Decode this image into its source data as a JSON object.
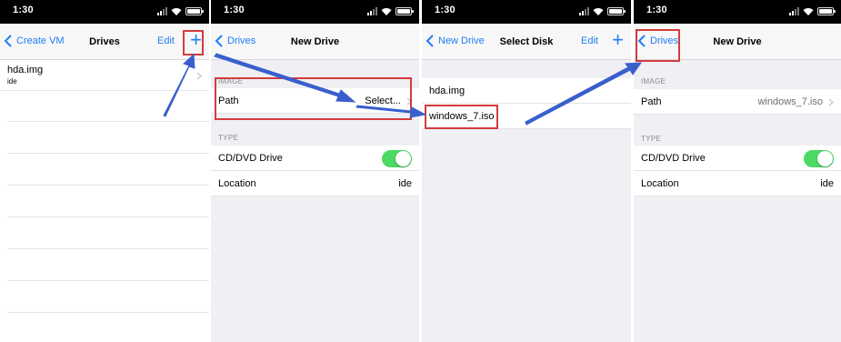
{
  "status": {
    "time": "1:30"
  },
  "screen1": {
    "nav": {
      "back": "Create VM",
      "title": "Drives",
      "edit": "Edit",
      "add": "+"
    },
    "drive": {
      "name": "hda.img",
      "interface": "ide"
    }
  },
  "screen2": {
    "nav": {
      "back": "Drives",
      "title": "New Drive"
    },
    "image_header": "IMAGE",
    "path_label": "Path",
    "path_value": "Select...",
    "type_header": "TYPE",
    "cd_label": "CD/DVD Drive",
    "location_label": "Location",
    "location_value": "ide"
  },
  "screen3": {
    "nav": {
      "back": "New Drive",
      "title": "Select Disk",
      "edit": "Edit",
      "add": "+"
    },
    "files": [
      "hda.img",
      "windows_7.iso"
    ]
  },
  "screen4": {
    "nav": {
      "back": "Drives",
      "title": "New Drive"
    },
    "image_header": "IMAGE",
    "path_label": "Path",
    "path_value": "windows_7.iso",
    "type_header": "TYPE",
    "cd_label": "CD/DVD Drive",
    "location_label": "Location",
    "location_value": "ide"
  },
  "colors": {
    "accent": "#1f7ef5",
    "toggle_on": "#4cd964",
    "callout": "#d43b3b",
    "arrow": "#3a5fcd"
  }
}
